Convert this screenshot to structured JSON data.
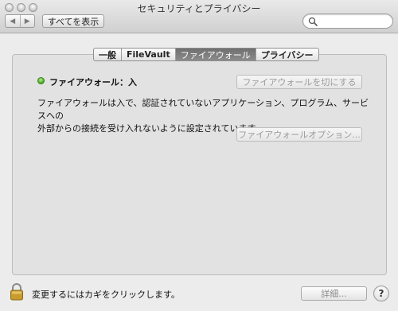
{
  "window": {
    "title": "セキュリティとプライバシー"
  },
  "toolbar": {
    "back_icon": "◀",
    "forward_icon": "▶",
    "show_all_label": "すべてを表示",
    "search": {
      "value": "",
      "placeholder": ""
    }
  },
  "tabs": [
    {
      "label": "一般",
      "active": false
    },
    {
      "label": "FileVault",
      "active": false
    },
    {
      "label": "ファイアウォール",
      "active": true
    },
    {
      "label": "プライバシー",
      "active": false
    }
  ],
  "firewall": {
    "status_label": "ファイアウォール：入",
    "status_color": "#3ea51c",
    "turn_off_button": "ファイアウォールを切にする",
    "description_line1": "ファイアウォールは入で、認証されていないアプリケーション、プログラム、サービスへの",
    "description_line2": "外部からの接続を受け入れないように設定されています。",
    "options_button": "ファイアウォールオプション..."
  },
  "footer": {
    "lock_text": "変更するにはカギをクリックします。",
    "details_button": "詳細...",
    "help_label": "?"
  }
}
